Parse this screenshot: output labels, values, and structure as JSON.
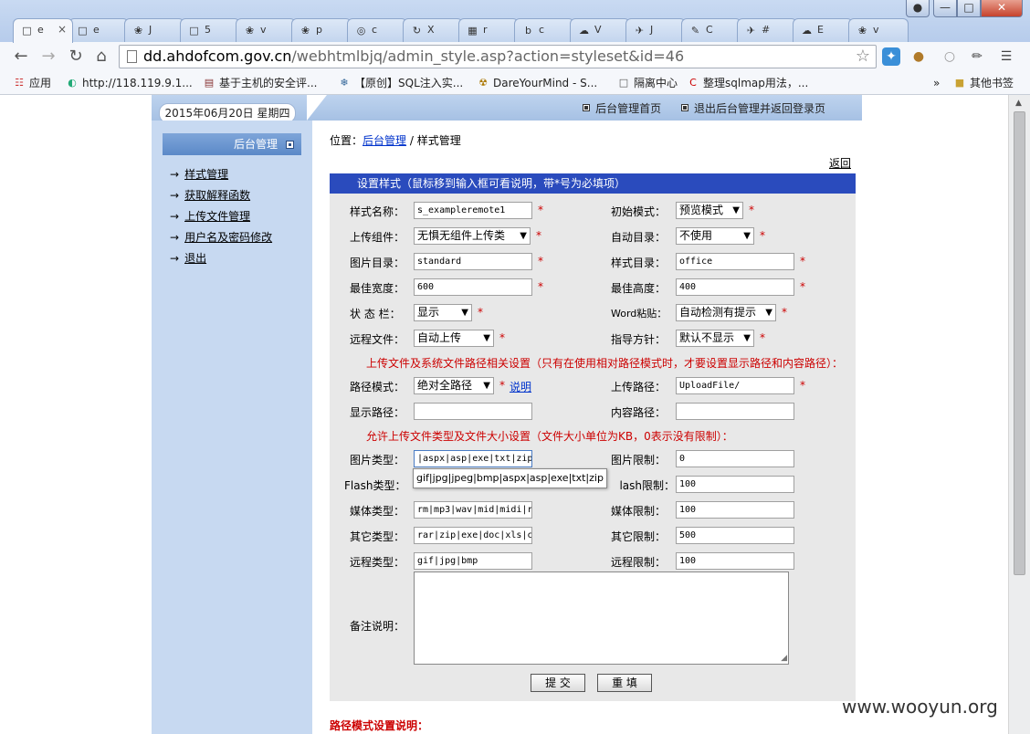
{
  "browser": {
    "tabs": [
      {
        "icon": "page-icon",
        "label": "e",
        "active": true
      },
      {
        "icon": "page-icon",
        "label": "e"
      },
      {
        "icon": "paw-icon",
        "label": "J"
      },
      {
        "icon": "page-icon",
        "label": "5"
      },
      {
        "icon": "paw-icon",
        "label": "v"
      },
      {
        "icon": "paw-icon",
        "label": "p"
      },
      {
        "icon": "chrome-icon",
        "label": "c"
      },
      {
        "icon": "loop-icon",
        "label": "X"
      },
      {
        "icon": "grid-icon",
        "label": "r"
      },
      {
        "icon": "b-icon",
        "label": "c"
      },
      {
        "icon": "cloud-icon",
        "label": "V"
      },
      {
        "icon": "bird-icon",
        "label": "J"
      },
      {
        "icon": "pen-icon",
        "label": "C"
      },
      {
        "icon": "bird-icon",
        "label": "#"
      },
      {
        "icon": "cloud-icon",
        "label": "E"
      },
      {
        "icon": "paw-icon",
        "label": "v"
      }
    ],
    "close_tab_glyph": "×",
    "url_host": "dd.ahdofcom.gov.cn",
    "url_path": "/webhtmlbjq/admin_style.asp?action=styleset&id=46",
    "bookmarks": [
      {
        "icon": "apps-icon",
        "label": "应用"
      },
      {
        "icon": "globe-icon",
        "label": "http://118.119.9.1..."
      },
      {
        "icon": "book-icon",
        "label": "基于主机的安全评..."
      },
      {
        "icon": "snowflake-icon",
        "label": "【原创】SQL注入实..."
      },
      {
        "icon": "radiation-icon",
        "label": "DareYourMind - S..."
      },
      {
        "icon": "page-icon",
        "label": "隔离中心"
      },
      {
        "icon": "c-icon",
        "label": "整理sqlmap用法，..."
      }
    ],
    "other_bookmarks": "其他书签",
    "more_glyph": "»"
  },
  "header": {
    "date": "2015年06月20日   星期四",
    "links": [
      "后台管理首页",
      "退出后台管理并返回登录页"
    ]
  },
  "sidebar": {
    "title": "后台管理",
    "items": [
      "样式管理",
      "获取解释函数",
      "上传文件管理",
      "用户名及密码修改",
      "退出"
    ],
    "arrow": "→"
  },
  "main": {
    "crumb_prefix": "位置：",
    "crumb_link": "后台管理",
    "crumb_sep": " / ",
    "crumb_current": "样式管理",
    "back": "返回",
    "form_title": "设置样式（鼠标移到输入框可看说明，带*号为必填项）",
    "required_mark": "*",
    "fields": {
      "style_name_label": "样式名称：",
      "style_name_value": "s_exampleremote1",
      "init_mode_label": "初始模式：",
      "init_mode_value": "预览模式",
      "upload_comp_label": "上传组件：",
      "upload_comp_value": "无惧无组件上传类",
      "auto_dir_label": "自动目录：",
      "auto_dir_value": "不使用",
      "image_dir_label": "图片目录：",
      "image_dir_value": "standard",
      "style_dir_label": "样式目录：",
      "style_dir_value": "office",
      "best_width_label": "最佳宽度：",
      "best_width_value": "600",
      "best_height_label": "最佳高度：",
      "best_height_value": "400",
      "status_bar_label": "状 态 栏：",
      "status_bar_value": "显示",
      "word_paste_label": "Word粘贴：",
      "word_paste_value": "自动检测有提示",
      "remote_file_label": "远程文件：",
      "remote_file_value": "自动上传",
      "guide_label": "指导方针：",
      "guide_value": "默认不显示",
      "path_note": "上传文件及系统文件路径相关设置（只有在使用相对路径模式时，才要设置显示路径和内容路径）：",
      "path_mode_label": "路径模式：",
      "path_mode_value": "绝对全路径",
      "path_mode_help": "说明",
      "upload_path_label": "上传路径：",
      "upload_path_value": "UploadFile/",
      "display_path_label": "显示路径：",
      "display_path_value": "",
      "content_path_label": "内容路径：",
      "content_path_value": "",
      "type_note": "允许上传文件类型及文件大小设置（文件大小单位为KB，0表示没有限制）：",
      "image_type_label": "图片类型：",
      "image_type_value": "|aspx|asp|exe|txt|zip",
      "image_limit_label": "图片限制：",
      "image_limit_value": "0",
      "autocomplete_value": "gif|jpg|jpeg|bmp|aspx|asp|exe|txt|zip",
      "flash_type_label": "Flash类型：",
      "flash_limit_label": "lash限制：",
      "flash_limit_value": "100",
      "media_type_label": "媒体类型：",
      "media_type_value": "rm|mp3|wav|mid|midi|r",
      "media_limit_label": "媒体限制：",
      "media_limit_value": "100",
      "other_type_label": "其它类型：",
      "other_type_value": "rar|zip|exe|doc|xls|c",
      "other_limit_label": "其它限制：",
      "other_limit_value": "500",
      "remote_type_label": "远程类型：",
      "remote_type_value": "gif|jpg|bmp",
      "remote_limit_label": "远程限制：",
      "remote_limit_value": "100",
      "remark_label": "备注说明："
    },
    "submit_label": "提 交",
    "reset_label": "重 填",
    "bottom_note": "路径模式设置说明："
  },
  "watermark": "www.wooyun.org",
  "colors": {
    "form_title_bg": "#2a4bbd",
    "sidebar_bg": "#c7d9f1",
    "required": "#cc0000",
    "link": "#0033cc"
  }
}
